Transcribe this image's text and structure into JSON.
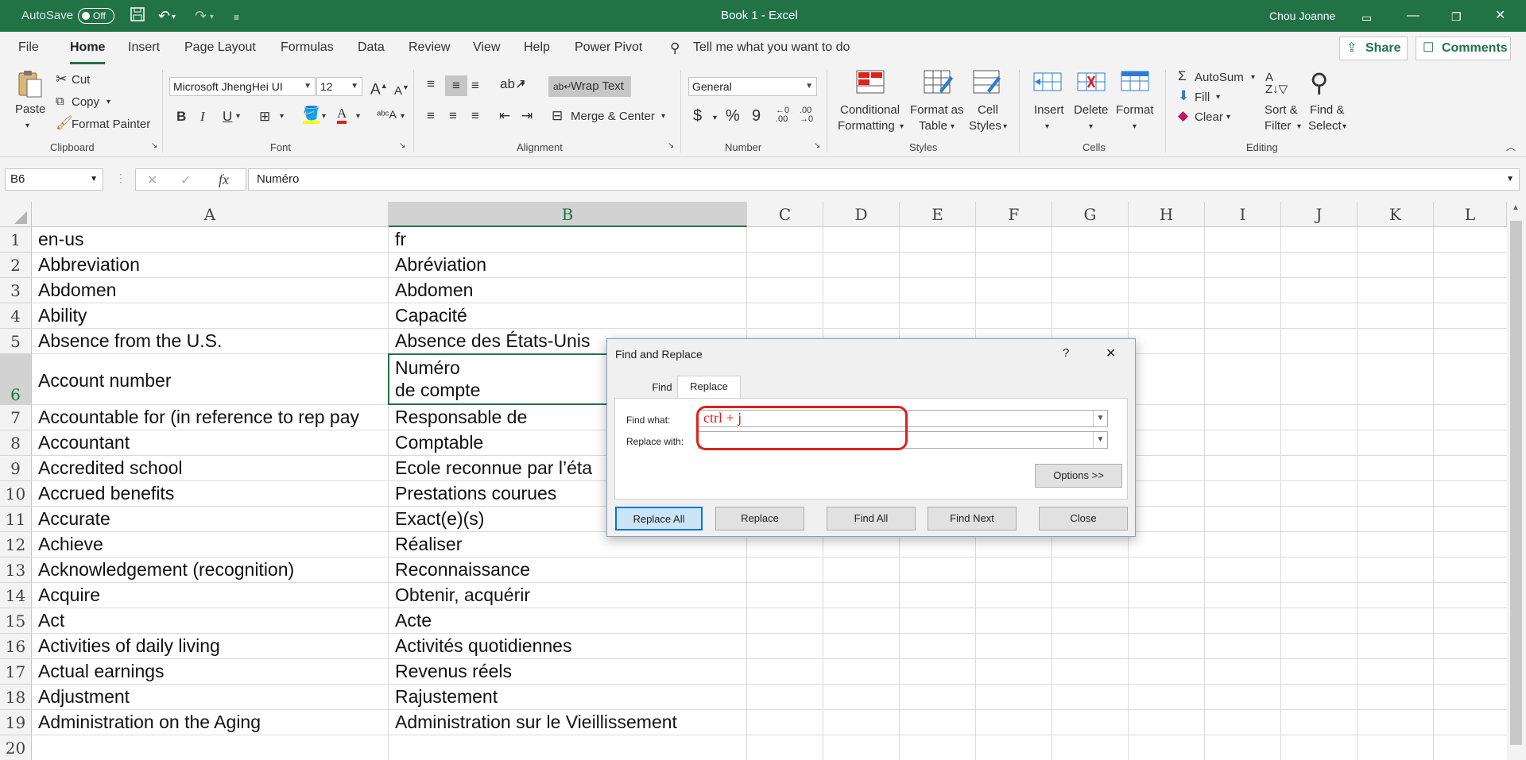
{
  "titlebar": {
    "autosave_label": "AutoSave",
    "autosave_state": "Off",
    "title": "Book 1  -  Excel",
    "user": "Chou Joanne"
  },
  "tabs": [
    "File",
    "Home",
    "Insert",
    "Page Layout",
    "Formulas",
    "Data",
    "Review",
    "View",
    "Help",
    "Power Pivot"
  ],
  "tell_me": "Tell me what you want to do",
  "share_label": "Share",
  "comments_label": "Comments",
  "ribbon": {
    "clipboard": {
      "paste": "Paste",
      "cut": "Cut",
      "copy": "Copy",
      "format_painter": "Format Painter",
      "group": "Clipboard"
    },
    "font": {
      "name": "Microsoft JhengHei UI",
      "size": "12",
      "bold": "B",
      "italic": "I",
      "underline": "U",
      "group": "Font"
    },
    "alignment": {
      "wrap_text": "Wrap Text",
      "merge_center": "Merge & Center",
      "group": "Alignment"
    },
    "number": {
      "format": "General",
      "currency": "$",
      "percent": "%",
      "comma": "9",
      "group": "Number"
    },
    "styles": {
      "conditional1": "Conditional",
      "conditional2": "Formatting",
      "format_as1": "Format as",
      "format_as2": "Table",
      "cell1": "Cell",
      "cell2": "Styles",
      "group": "Styles"
    },
    "cells": {
      "insert": "Insert",
      "delete": "Delete",
      "format": "Format",
      "group": "Cells"
    },
    "editing": {
      "autosum": "AutoSum",
      "fill": "Fill",
      "clear": "Clear",
      "sort1": "Sort &",
      "sort2": "Filter",
      "find1": "Find &",
      "find2": "Select",
      "group": "Editing"
    }
  },
  "formula_bar": {
    "name_box": "B6",
    "fx": "fx",
    "content": "Numéro"
  },
  "columns": [
    "A",
    "B",
    "C",
    "D",
    "E",
    "F",
    "G",
    "H",
    "I",
    "J",
    "K",
    "L"
  ],
  "rows": [
    "1",
    "2",
    "3",
    "4",
    "5",
    "6",
    "7",
    "8",
    "9",
    "10",
    "11",
    "12",
    "13",
    "14",
    "15",
    "16",
    "17",
    "18",
    "19",
    "20"
  ],
  "cells": [
    {
      "a": "en-us",
      "b": "fr"
    },
    {
      "a": "Abbreviation",
      "b": "Abréviation"
    },
    {
      "a": "Abdomen",
      "b": "Abdomen"
    },
    {
      "a": "Ability",
      "b": "Capacité"
    },
    {
      "a": "Absence from the U.S.",
      "b": "Absence des États-Unis"
    },
    {
      "a": "Account number",
      "b1": "Numéro",
      "b2": "de compte"
    },
    {
      "a": "Accountable for (in reference to rep pay",
      "b": "Responsable de"
    },
    {
      "a": "Accountant",
      "b": "Comptable"
    },
    {
      "a": "Accredited school",
      "b": "Ecole reconnue par l’éta"
    },
    {
      "a": "Accrued benefits",
      "b": "Prestations courues"
    },
    {
      "a": "Accurate",
      "b": "Exact(e)(s)"
    },
    {
      "a": "Achieve",
      "b": "Réaliser"
    },
    {
      "a": "Acknowledgement (recognition)",
      "b": "Reconnaissance"
    },
    {
      "a": "Acquire",
      "b": "Obtenir, acquérir"
    },
    {
      "a": "Act",
      "b": "Acte"
    },
    {
      "a": "Activities of daily living",
      "b": "Activités quotidiennes"
    },
    {
      "a": "Actual earnings",
      "b": "Revenus réels"
    },
    {
      "a": "Adjustment",
      "b": "Rajustement"
    },
    {
      "a": "Administration on the Aging",
      "b": "Administration sur le Vieillissement"
    }
  ],
  "dialog": {
    "title": "Find and Replace",
    "help": "?",
    "close_x": "✕",
    "tab_find": "Find",
    "tab_replace": "Replace",
    "find_label": "Find what:",
    "find_value": "ctrl + j",
    "replace_label": "Replace with:",
    "replace_value": "",
    "options": "Options >>",
    "replace_all": "Replace All",
    "replace": "Replace",
    "find_all": "Find All",
    "find_next": "Find Next",
    "close": "Close"
  },
  "colors": {
    "excel_green": "#217346",
    "highlight_red": "#e0201b"
  }
}
